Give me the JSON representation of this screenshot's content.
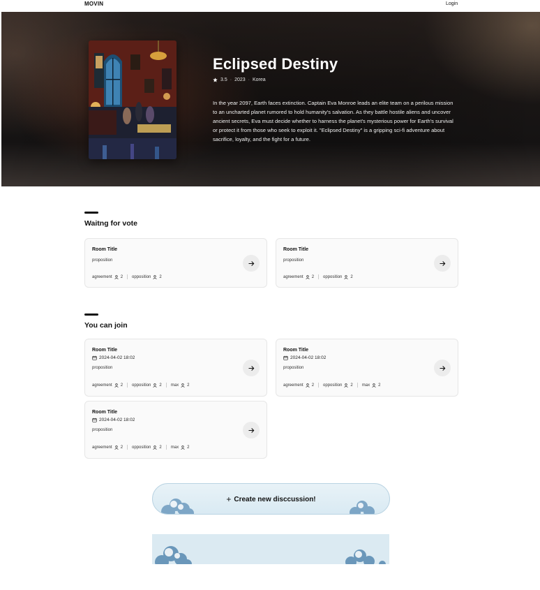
{
  "header": {
    "logo": "MOVIN",
    "login_label": "Login"
  },
  "hero": {
    "title": "Eclipsed Destiny",
    "rating": "3.5",
    "year": "2023",
    "country": "Korea",
    "description": "In the year 2097, Earth faces extinction. Captain Eva Monroe leads an elite team on a perilous mission to an uncharted planet rumored to hold humanity's salvation. As they battle hostile aliens and uncover ancient secrets, Eva must decide whether to harness the planet's mysterious power for Earth's survival or protect it from those who seek to exploit it. \"Eclipsed Destiny\" is a gripping sci-fi adventure about sacrifice, loyalty, and the fight for a future."
  },
  "voting": {
    "heading": "Waitng for vote",
    "rooms": [
      {
        "title": "Room Title",
        "proposition": "proposition",
        "agreement_label": "agreement",
        "agreement": "2",
        "opposition_label": "opposition",
        "opposition": "2"
      },
      {
        "title": "Room Title",
        "proposition": "proposition",
        "agreement_label": "agreement",
        "agreement": "2",
        "opposition_label": "opposition",
        "opposition": "2"
      }
    ]
  },
  "joinable": {
    "heading": "You can join",
    "rooms": [
      {
        "title": "Room Title",
        "date": "2024-04-02 18:02",
        "proposition": "proposition",
        "agreement_label": "agreement",
        "agreement": "2",
        "opposition_label": "opposition",
        "opposition": "2",
        "max_label": "max",
        "max": "2"
      },
      {
        "title": "Room Title",
        "date": "2024-04-02 18:02",
        "proposition": "proposition",
        "agreement_label": "agreement",
        "agreement": "2",
        "opposition_label": "opposition",
        "opposition": "2",
        "max_label": "max",
        "max": "2"
      },
      {
        "title": "Room Title",
        "date": "2024-04-02 18:02",
        "proposition": "proposition",
        "agreement_label": "agreement",
        "agreement": "2",
        "opposition_label": "opposition",
        "opposition": "2",
        "max_label": "max",
        "max": "2"
      }
    ]
  },
  "create_button": {
    "label": "Create new disccussion!"
  },
  "icons": {
    "rating": "star-icon",
    "date": "calendar-icon",
    "people": "person-icon",
    "enter": "arrow-right-icon",
    "create": "plus-icon"
  }
}
